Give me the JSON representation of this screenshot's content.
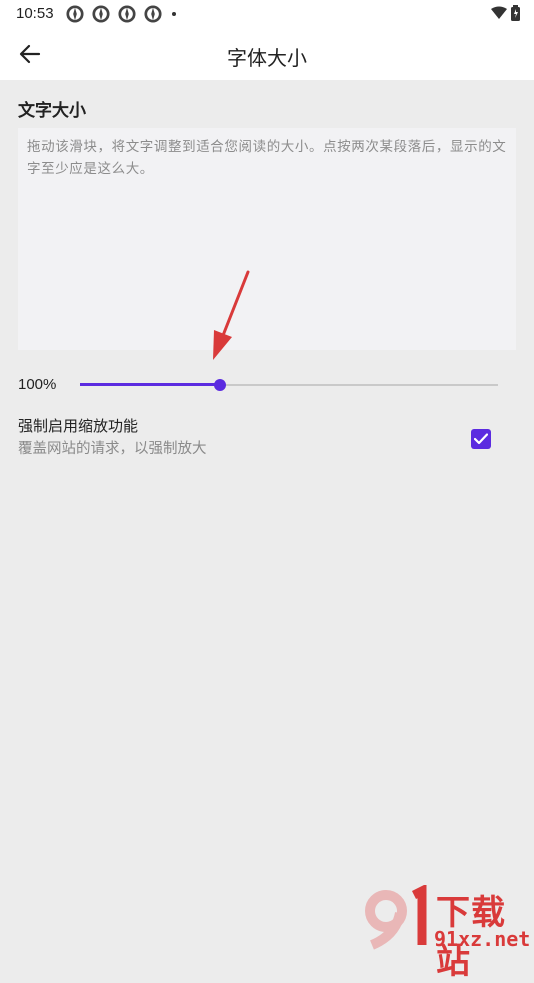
{
  "status_bar": {
    "time": "10:53",
    "left_icons": [
      "notification-icon",
      "notification-icon",
      "notification-icon",
      "notification-icon"
    ],
    "right_icons": [
      "wifi-icon",
      "battery-icon"
    ]
  },
  "app_bar": {
    "title": "字体大小",
    "back_icon": "arrow-left-icon"
  },
  "text_size": {
    "section_title": "文字大小",
    "preview_text": "拖动该滑块，将文字调整到适合您阅读的大小。点按两次某段落后，显示的文字至少应是这么大。",
    "percent_label": "100%",
    "slider_fraction": 0.335
  },
  "force_zoom": {
    "title": "强制启用缩放功能",
    "subtitle": "覆盖网站的请求，以强制放大",
    "checked": true
  },
  "watermark": {
    "brand": "下载站",
    "domain": "91xz.net"
  },
  "colors": {
    "accent": "#5b2be0",
    "annotation_arrow": "#d93a3a",
    "background": "#ececec"
  }
}
